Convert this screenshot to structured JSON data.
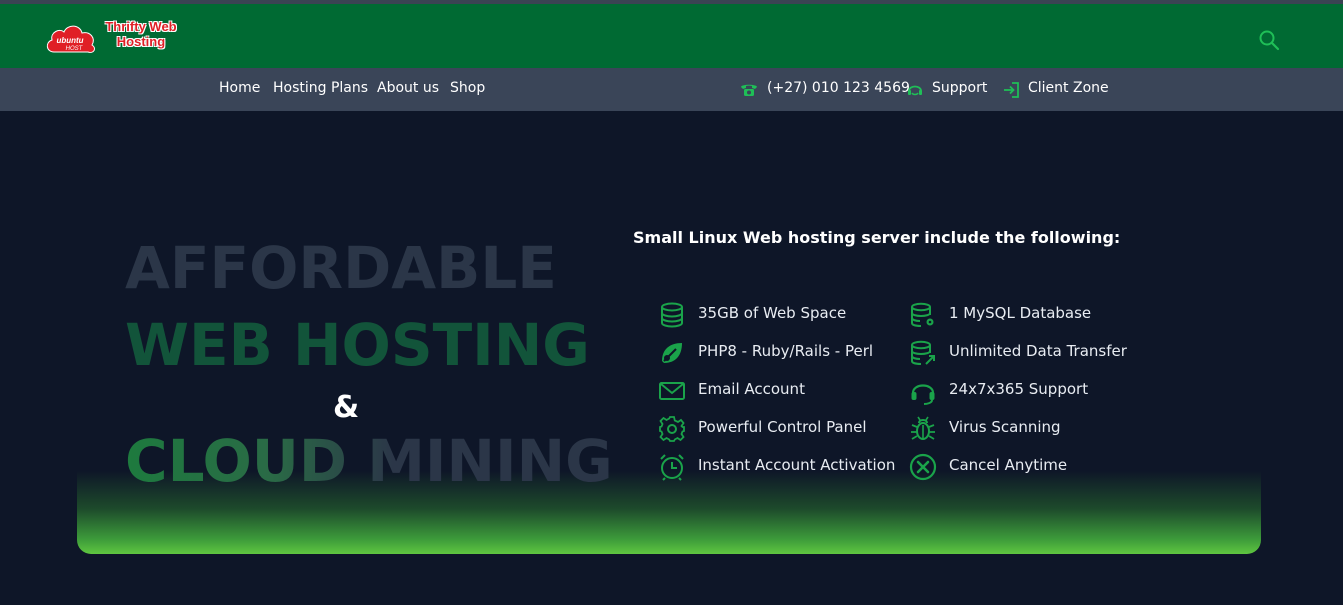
{
  "header": {
    "logo_badge": "ubuntu HOST",
    "logo_text": "Thrifty Web Hosting",
    "search_icon": "search-icon"
  },
  "nav": {
    "links": [
      "Home",
      "Hosting Plans",
      "About us",
      "Shop"
    ],
    "phone": "(+27) 010 123 4569",
    "support": "Support",
    "client_zone": "Client Zone"
  },
  "hero": {
    "line1": "AFFORDABLE",
    "line2": "WEB HOSTING",
    "amp": "&",
    "line3": "CLOUD MINING",
    "features_title": "Small Linux Web hosting server include the following:",
    "features_left": [
      {
        "label": "35GB of Web Space",
        "icon": "database-icon"
      },
      {
        "label": "PHP8 - Ruby/Rails - Perl",
        "icon": "code-leaf-icon"
      },
      {
        "label": "Email Account",
        "icon": "envelope-icon"
      },
      {
        "label": "Powerful Control Panel",
        "icon": "gear-icon"
      },
      {
        "label": "Instant Account Activation",
        "icon": "alarm-clock-icon"
      }
    ],
    "features_right": [
      {
        "label": "1 MySQL Database",
        "icon": "database-gear-icon"
      },
      {
        "label": "Unlimited Data Transfer",
        "icon": "database-transfer-icon"
      },
      {
        "label": "24x7x365 Support",
        "icon": "headset-icon"
      },
      {
        "label": "Virus Scanning",
        "icon": "bug-icon"
      },
      {
        "label": "Cancel Anytime",
        "icon": "cancel-circle-icon"
      }
    ]
  },
  "colors": {
    "header_green": "#006a33",
    "nav_bg": "#3a4558",
    "page_bg": "#0e1628",
    "icon_green": "#1aa34a"
  }
}
